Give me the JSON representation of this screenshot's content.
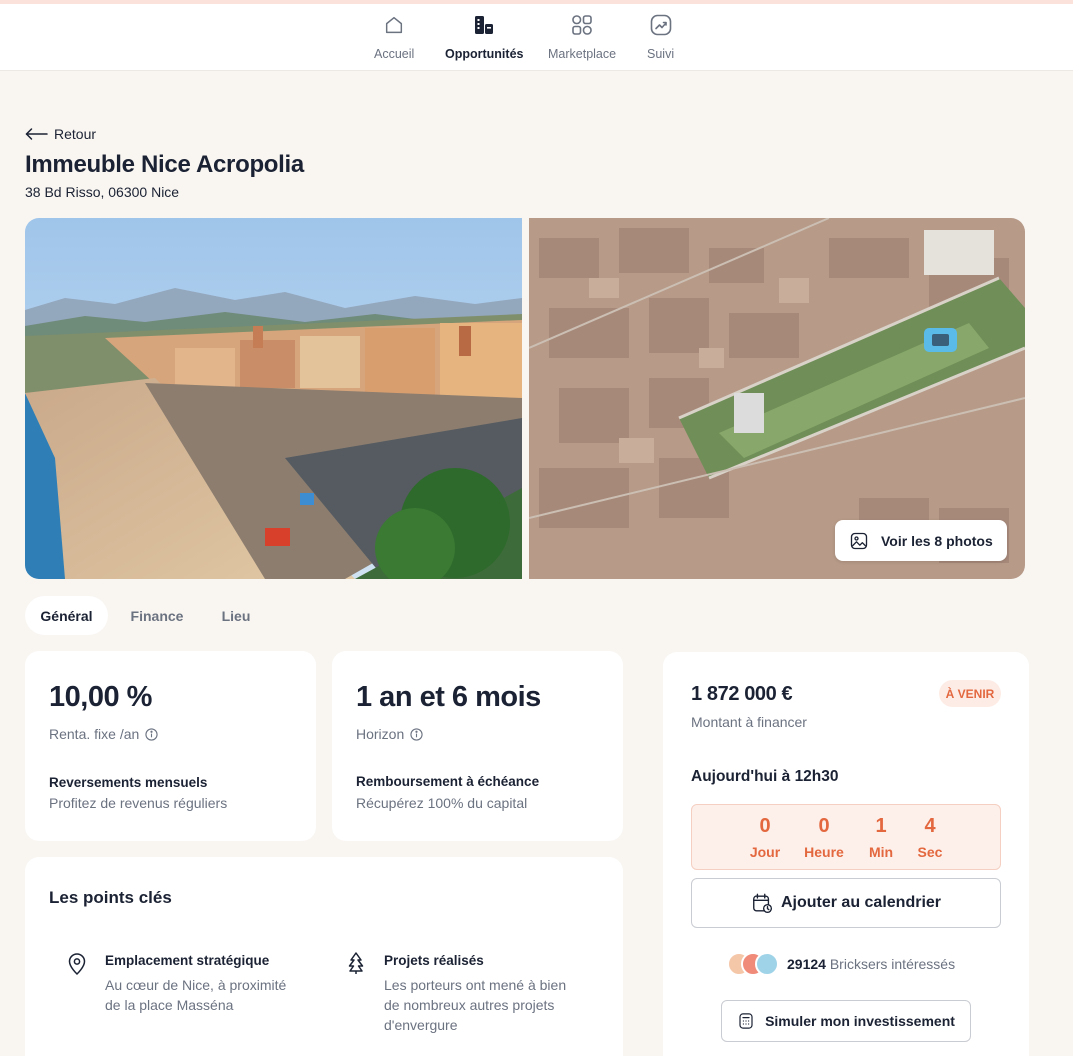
{
  "nav": {
    "items": [
      {
        "label": "Accueil",
        "icon": "home-icon"
      },
      {
        "label": "Opportunités",
        "icon": "buildings-icon"
      },
      {
        "label": "Marketplace",
        "icon": "marketplace-icon"
      },
      {
        "label": "Suivi",
        "icon": "chart-up-icon"
      }
    ]
  },
  "header": {
    "back_label": "Retour",
    "title": "Immeuble Nice Acropolia",
    "address": "38 Bd Risso, 06300 Nice"
  },
  "gallery": {
    "photos_button_label": "Voir les 8 photos"
  },
  "tabs": [
    {
      "label": "Général"
    },
    {
      "label": "Finance"
    },
    {
      "label": "Lieu"
    }
  ],
  "stats": {
    "rent": {
      "value": "10,00 %",
      "label": "Renta. fixe /an",
      "detail_title": "Reversements mensuels",
      "detail_text": "Profitez de revenus réguliers"
    },
    "horizon": {
      "value": "1 an et 6 mois",
      "label": "Horizon",
      "detail_title": "Remboursement à échéance",
      "detail_text": "Récupérez 100% du capital"
    }
  },
  "funding": {
    "amount": "1 872 000 €",
    "amount_label": "Montant à financer",
    "status": "À VENIR",
    "start_text": "Aujourd'hui à 12h30",
    "countdown": [
      {
        "value": "0",
        "unit": "Jour"
      },
      {
        "value": "0",
        "unit": "Heure"
      },
      {
        "value": "1",
        "unit": "Min"
      },
      {
        "value": "4",
        "unit": "Sec"
      }
    ],
    "calendar_label": "Ajouter au calendrier",
    "interested_count": "29124",
    "interested_label": "Bricksers intéressés",
    "simulate_label": "Simuler mon investissement"
  },
  "key_points": {
    "title": "Les points clés",
    "items": [
      {
        "title": "Emplacement stratégique",
        "text_lines": [
          "Au cœur de Nice, à proximité",
          "de la place Masséna"
        ],
        "icon": "location-pin-icon"
      },
      {
        "title": "Projets réalisés",
        "text_lines": [
          "Les porteurs ont mené à bien",
          "de nombreux autres projets",
          "d'envergure"
        ],
        "icon": "tree-icon"
      }
    ]
  },
  "colors": {
    "accent": "#e3683f",
    "background": "#f9f6f2",
    "text": "#1b2233",
    "muted": "#6b7280"
  }
}
